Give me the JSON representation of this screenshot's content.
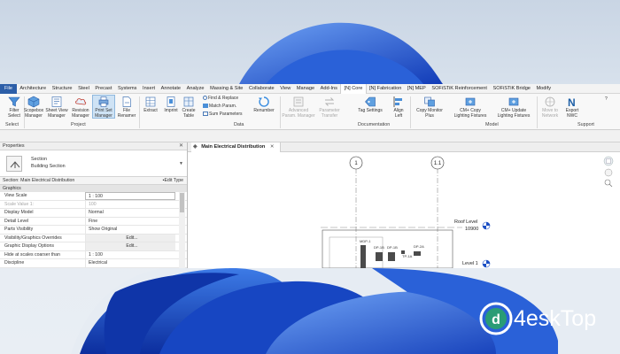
{
  "menu": {
    "tabs": [
      "File",
      "Architecture",
      "Structure",
      "Steel",
      "Precast",
      "Systems",
      "Insert",
      "Annotate",
      "Analyze",
      "Massing & Site",
      "Collaborate",
      "View",
      "Manage",
      "Add-Ins",
      "[N] Core",
      "[N] Fabrication",
      "[N] MEP",
      "SOFiSTiK Reinforcement",
      "SOFiSTiK Bridge",
      "Modify"
    ],
    "active_tab": "[N] Core"
  },
  "ribbon": {
    "buttons": {
      "filter_select": "Filter\nSelect",
      "scopebox_manager": "Scopebox\nManager",
      "sheet_view_manager": "Sheet View\nManager",
      "revision_manager": "Revision\nManager",
      "print_set_manager": "Print Set\nManager",
      "file_renamer": "File\nRenamer",
      "extract": "Extract",
      "imprint": "Imprint",
      "create_table": "Create\nTable",
      "renumber": "Renumber",
      "advanced_param_manager": "Advanced\nParam. Manager",
      "parameter_transfer": "Parameter\nTransfer",
      "tag_settings": "Tag Settings",
      "align_left": "Align\nLeft",
      "copy_monitor_plus": "Copy Monitor\nPlus",
      "cm_copy_lighting": "CM+ Copy\nLighting Fixtures",
      "cm_update_lighting": "CM+ Update\nLighting Fixtures",
      "move_to_network": "Move to\nNetwork",
      "export_nwc": "Export\nNWC"
    },
    "small_buttons": {
      "find_replace": "Find & Replace",
      "match_param": "Match Param.",
      "sum_parameters": "Sum Parameters"
    },
    "groups": {
      "select": "Select",
      "project": "Project",
      "data": "Data",
      "documentation": "Documentation",
      "model": "Model",
      "support": "Support"
    }
  },
  "properties": {
    "panel_title": "Properties",
    "type_name": "Section",
    "type_sub": "Building Section",
    "instance_label": "Section: Main Electrical Distribution",
    "edit_type": "Edit Type",
    "category": "Graphics",
    "rows": [
      {
        "k": "View Scale",
        "v": "1 : 100"
      },
      {
        "k": "Scale Value    1:",
        "v": "100"
      },
      {
        "k": "Display Model",
        "v": "Normal"
      },
      {
        "k": "Detail Level",
        "v": "Fine"
      },
      {
        "k": "Parts Visibility",
        "v": "Show Original"
      },
      {
        "k": "Visibility/Graphics Overrides",
        "v": "Edit..."
      },
      {
        "k": "Graphic Display Options",
        "v": "Edit..."
      },
      {
        "k": "Hide at scales coarser than",
        "v": "1 : 100"
      },
      {
        "k": "Discipline",
        "v": "Electrical"
      }
    ]
  },
  "view": {
    "tab_label": "Main Electrical Distribution",
    "grid_labels": [
      "1",
      "1.1"
    ],
    "levels": [
      {
        "name": "Roof Level",
        "elevation": "10900"
      },
      {
        "name": "Level 1",
        "elevation": ""
      }
    ],
    "equipment_tags": [
      "MDP-1",
      "DP-1B",
      "DP-1B",
      "DP-2A",
      "TP-1A"
    ]
  },
  "watermark": {
    "text": "4eskTop",
    "mark_text": "d"
  },
  "colors": {
    "accent": "#2c5ea8",
    "wallpaper_blue": "#1b4fc4"
  }
}
